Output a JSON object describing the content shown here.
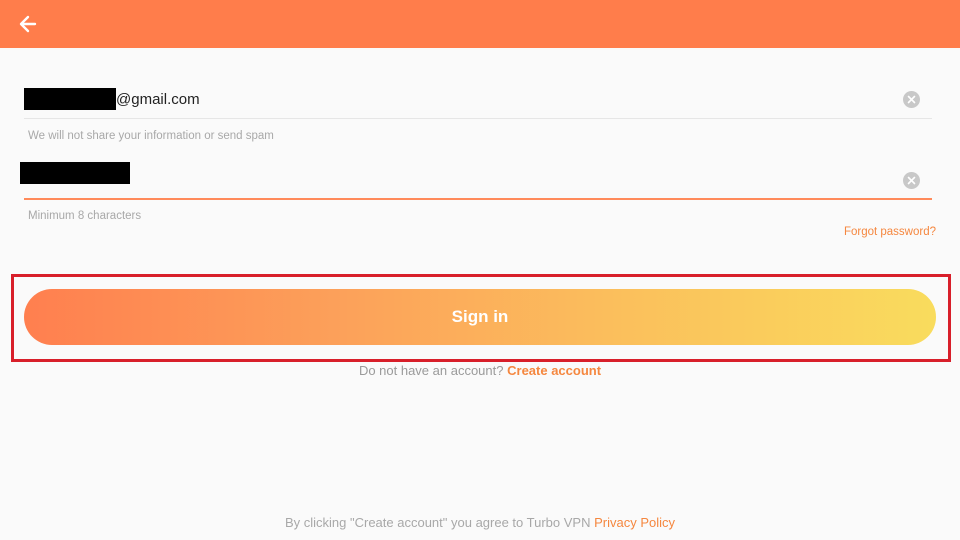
{
  "header": {
    "back_icon": "arrow-left-icon",
    "background_color": "#ff7d4b"
  },
  "email": {
    "value_visible": "@gmail.com",
    "hint": "We will not share your information or send spam",
    "clear_icon": "clear-circle-icon"
  },
  "password": {
    "hint": "Minimum 8 characters",
    "clear_icon": "clear-circle-icon",
    "underline_color": "#ff8a5a"
  },
  "forgot_password": "Forgot password?",
  "sign_in": {
    "label": "Sign in",
    "gradient_colors": [
      "#ff7f4f",
      "#f9dc5d"
    ]
  },
  "signup": {
    "prompt": "Do not have an account?",
    "link": "Create account"
  },
  "footer": {
    "text": "By clicking \"Create account\" you agree to Turbo VPN",
    "link": "Privacy Policy"
  },
  "annotation": {
    "highlight_color": "#d81f2a"
  },
  "accent_color": "#f5873f"
}
